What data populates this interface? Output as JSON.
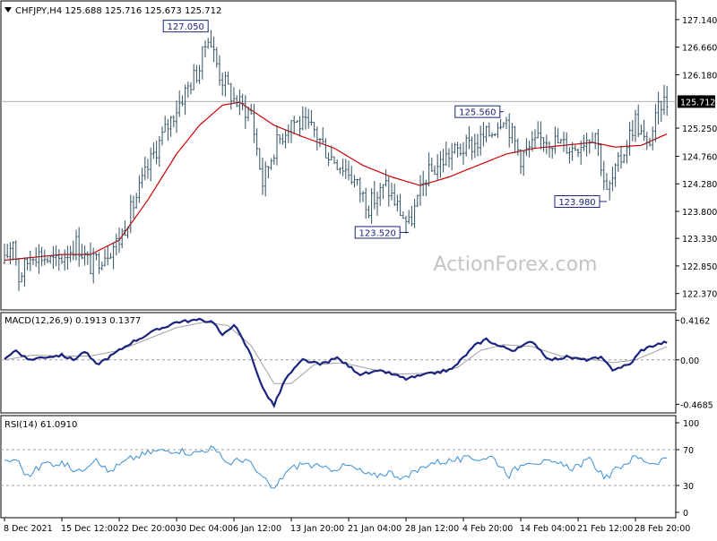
{
  "colors": {
    "background": "#ffffff",
    "frame": "#000000",
    "candle": "#2f5061",
    "moving_average": "#d10000",
    "macd_main": "#1a237e",
    "macd_signal": "#a0a0a0",
    "rsi_line": "#3b8fd6",
    "rsi_levels": "#a0a0a0",
    "price_marker_bg": "#000000",
    "price_marker_text": "#ffffff",
    "callout_border": "#1a237e",
    "callout_text": "#1a237e",
    "watermark": "#c4c4c4"
  },
  "header": {
    "symbol_line": "CHFJPY,H4  125.688 125.716 125.673 125.712"
  },
  "watermark": "ActionForex.com",
  "chart_data": [
    {
      "type": "candlestick",
      "ylim": [
        122.1,
        127.45
      ],
      "y_ticks": [
        "127.140",
        "126.660",
        "126.180",
        "125.712",
        "125.250",
        "124.760",
        "124.280",
        "123.800",
        "123.330",
        "122.850",
        "122.370"
      ],
      "current_price_label": "125.712",
      "current_price": 125.712,
      "x_tick_labels": [
        "8 Dec 2021",
        "15 Dec 12:00",
        "22 Dec 20:00",
        "30 Dec 04:00",
        "6 Jan 12:00",
        "13 Jan 20:00",
        "21 Jan 04:00",
        "28 Jan 12:00",
        "4 Feb 20:00",
        "14 Feb 04:00",
        "21 Feb 12:00",
        "28 Feb 20:00"
      ],
      "annotations": [
        {
          "label": "127.050",
          "value": 127.05,
          "bar": 71
        },
        {
          "label": "125.560",
          "value": 125.56,
          "bar": 174
        },
        {
          "label": "123.520",
          "value": 123.52,
          "bar": 141
        },
        {
          "label": "123.980",
          "value": 123.98,
          "bar": 210
        }
      ],
      "price_anchors": [
        [
          0,
          122.9
        ],
        [
          3,
          123.35
        ],
        [
          5,
          122.65
        ],
        [
          10,
          123.1
        ],
        [
          18,
          122.9
        ],
        [
          25,
          123.25
        ],
        [
          30,
          122.85
        ],
        [
          40,
          123.3
        ],
        [
          52,
          124.8
        ],
        [
          62,
          125.8
        ],
        [
          68,
          126.3
        ],
        [
          71,
          126.9
        ],
        [
          75,
          126.2
        ],
        [
          80,
          125.75
        ],
        [
          86,
          125.5
        ],
        [
          90,
          124.3
        ],
        [
          94,
          124.9
        ],
        [
          100,
          125.4
        ],
        [
          108,
          125.2
        ],
        [
          113,
          124.8
        ],
        [
          120,
          124.5
        ],
        [
          127,
          123.9
        ],
        [
          133,
          124.25
        ],
        [
          138,
          123.8
        ],
        [
          141,
          123.55
        ],
        [
          147,
          124.4
        ],
        [
          155,
          124.8
        ],
        [
          165,
          125.0
        ],
        [
          170,
          125.2
        ],
        [
          174,
          125.5
        ],
        [
          180,
          124.75
        ],
        [
          188,
          125.1
        ],
        [
          198,
          124.9
        ],
        [
          206,
          125.2
        ],
        [
          210,
          124.1
        ],
        [
          214,
          124.6
        ],
        [
          220,
          125.4
        ],
        [
          224,
          124.9
        ],
        [
          229,
          125.7
        ],
        [
          231,
          125.71
        ]
      ],
      "moving_average_anchors": [
        [
          0,
          122.95
        ],
        [
          20,
          123.05
        ],
        [
          30,
          123.05
        ],
        [
          40,
          123.3
        ],
        [
          50,
          124.0
        ],
        [
          60,
          124.8
        ],
        [
          68,
          125.3
        ],
        [
          76,
          125.65
        ],
        [
          82,
          125.7
        ],
        [
          88,
          125.5
        ],
        [
          94,
          125.3
        ],
        [
          104,
          125.1
        ],
        [
          115,
          124.9
        ],
        [
          125,
          124.6
        ],
        [
          135,
          124.4
        ],
        [
          145,
          124.25
        ],
        [
          155,
          124.4
        ],
        [
          165,
          124.6
        ],
        [
          175,
          124.8
        ],
        [
          185,
          124.9
        ],
        [
          195,
          124.95
        ],
        [
          205,
          125.0
        ],
        [
          213,
          124.92
        ],
        [
          222,
          124.95
        ],
        [
          231,
          125.15
        ]
      ]
    },
    {
      "type": "line",
      "name": "MACD(12,26,9) 0.1913 0.1377",
      "ylim": [
        -0.55,
        0.47
      ],
      "y_ticks": [
        "0.4162",
        "0.00",
        "-0.4685"
      ],
      "series": [
        {
          "name": "MACD",
          "value": 0.1913
        },
        {
          "name": "Signal",
          "value": 0.1377
        }
      ],
      "macd_anchors": [
        [
          0,
          0.02
        ],
        [
          4,
          0.1
        ],
        [
          8,
          0.0
        ],
        [
          14,
          0.03
        ],
        [
          20,
          0.05
        ],
        [
          24,
          0.0
        ],
        [
          28,
          0.09
        ],
        [
          32,
          -0.05
        ],
        [
          36,
          0.02
        ],
        [
          44,
          0.18
        ],
        [
          52,
          0.3
        ],
        [
          60,
          0.4
        ],
        [
          68,
          0.42
        ],
        [
          73,
          0.4
        ],
        [
          76,
          0.25
        ],
        [
          80,
          0.38
        ],
        [
          86,
          0.05
        ],
        [
          90,
          -0.3
        ],
        [
          94,
          -0.48
        ],
        [
          98,
          -0.2
        ],
        [
          104,
          0.0
        ],
        [
          110,
          -0.05
        ],
        [
          116,
          0.02
        ],
        [
          124,
          -0.15
        ],
        [
          132,
          -0.12
        ],
        [
          140,
          -0.2
        ],
        [
          148,
          -0.15
        ],
        [
          156,
          -0.1
        ],
        [
          164,
          0.15
        ],
        [
          168,
          0.22
        ],
        [
          172,
          0.15
        ],
        [
          178,
          0.1
        ],
        [
          184,
          0.2
        ],
        [
          190,
          0.0
        ],
        [
          196,
          0.03
        ],
        [
          202,
          0.0
        ],
        [
          208,
          0.02
        ],
        [
          212,
          -0.1
        ],
        [
          218,
          -0.05
        ],
        [
          222,
          0.1
        ],
        [
          226,
          0.15
        ],
        [
          231,
          0.19
        ]
      ],
      "signal_anchors": [
        [
          0,
          0.0
        ],
        [
          10,
          0.05
        ],
        [
          20,
          0.04
        ],
        [
          30,
          0.04
        ],
        [
          40,
          0.1
        ],
        [
          50,
          0.22
        ],
        [
          60,
          0.34
        ],
        [
          70,
          0.4
        ],
        [
          78,
          0.36
        ],
        [
          86,
          0.15
        ],
        [
          94,
          -0.25
        ],
        [
          100,
          -0.25
        ],
        [
          108,
          -0.05
        ],
        [
          118,
          -0.03
        ],
        [
          128,
          -0.1
        ],
        [
          138,
          -0.15
        ],
        [
          148,
          -0.14
        ],
        [
          158,
          -0.08
        ],
        [
          166,
          0.1
        ],
        [
          174,
          0.16
        ],
        [
          184,
          0.14
        ],
        [
          194,
          0.04
        ],
        [
          204,
          0.01
        ],
        [
          212,
          -0.03
        ],
        [
          220,
          0.0
        ],
        [
          231,
          0.14
        ]
      ]
    },
    {
      "type": "line",
      "name": "RSI(14) 61.0910",
      "ylim": [
        0,
        100
      ],
      "y_ticks": [
        "100",
        "70",
        "30",
        "0"
      ],
      "levels": [
        70,
        30
      ],
      "current_value": 61.091,
      "rsi_anchors": [
        [
          0,
          55
        ],
        [
          4,
          60
        ],
        [
          8,
          40
        ],
        [
          14,
          55
        ],
        [
          20,
          55
        ],
        [
          26,
          45
        ],
        [
          32,
          62
        ],
        [
          36,
          45
        ],
        [
          44,
          60
        ],
        [
          52,
          68
        ],
        [
          60,
          70
        ],
        [
          66,
          66
        ],
        [
          72,
          72
        ],
        [
          78,
          55
        ],
        [
          84,
          60
        ],
        [
          90,
          38
        ],
        [
          94,
          25
        ],
        [
          98,
          45
        ],
        [
          104,
          55
        ],
        [
          112,
          48
        ],
        [
          120,
          52
        ],
        [
          128,
          40
        ],
        [
          134,
          45
        ],
        [
          140,
          38
        ],
        [
          148,
          55
        ],
        [
          156,
          58
        ],
        [
          164,
          60
        ],
        [
          170,
          62
        ],
        [
          176,
          42
        ],
        [
          182,
          58
        ],
        [
          190,
          55
        ],
        [
          198,
          50
        ],
        [
          204,
          58
        ],
        [
          210,
          38
        ],
        [
          214,
          50
        ],
        [
          220,
          62
        ],
        [
          226,
          55
        ],
        [
          231,
          61
        ]
      ]
    }
  ]
}
